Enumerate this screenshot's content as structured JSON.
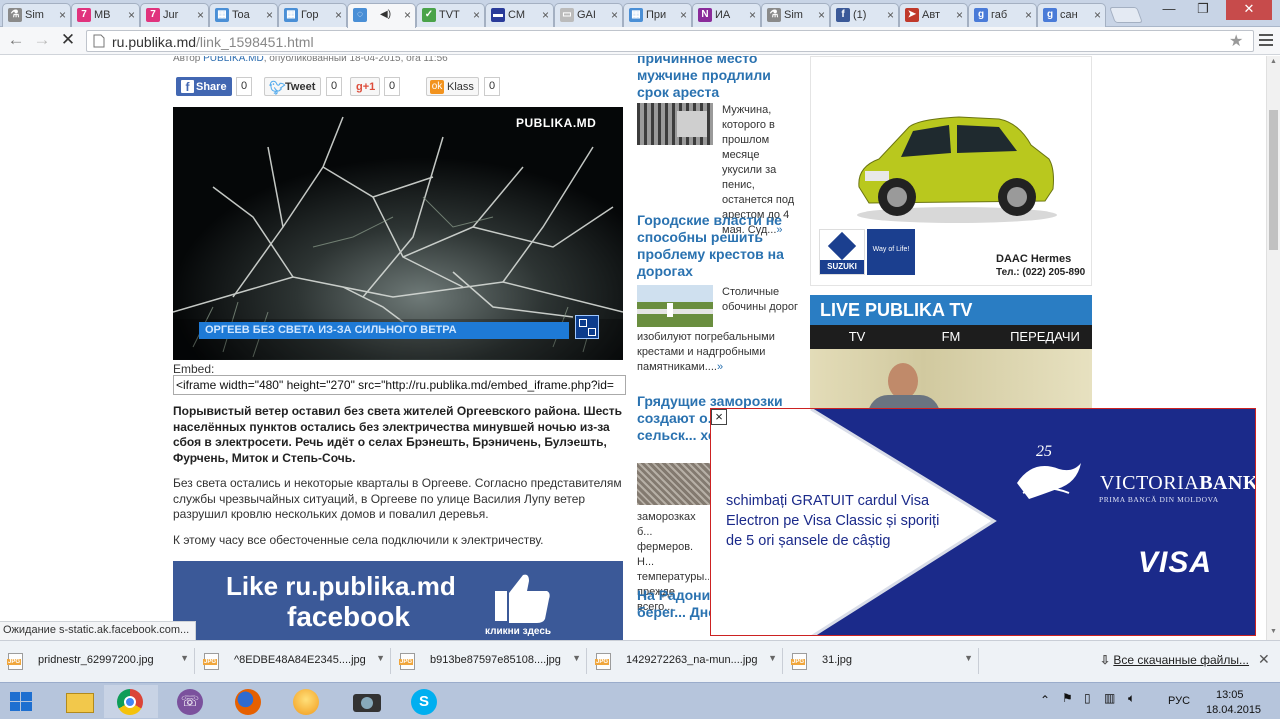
{
  "tabs": [
    {
      "label": "Sim",
      "icon": "flask-icon",
      "color": "#8a8a8a"
    },
    {
      "label": "MB",
      "icon": "seven-icon",
      "color": "#e0337d"
    },
    {
      "label": "Jur",
      "icon": "seven-icon",
      "color": "#e0337d"
    },
    {
      "label": "Toa",
      "icon": "grid-icon",
      "color": "#4a8fd6"
    },
    {
      "label": "Гор",
      "icon": "grid-icon",
      "color": "#4a8fd6"
    },
    {
      "label": "",
      "icon": "loading-icon",
      "color": "#4a8fd6",
      "audio": "◀)"
    },
    {
      "label": "TVT",
      "icon": "check-icon",
      "color": "#4aa34a"
    },
    {
      "label": "СМ",
      "icon": "flag-icon",
      "color": "#2a3b9a"
    },
    {
      "label": "GAI",
      "icon": "page-icon",
      "color": "#bbbbbb"
    },
    {
      "label": "При",
      "icon": "grid-icon",
      "color": "#4a8fd6"
    },
    {
      "label": "ИА",
      "icon": "news-icon",
      "color": "#8a2b9a"
    },
    {
      "label": "Sim",
      "icon": "flask-icon",
      "color": "#8a8a8a"
    },
    {
      "label": "(1)",
      "icon": "facebook-icon",
      "color": "#3b5998"
    },
    {
      "label": "Авт",
      "icon": "arrow-icon",
      "color": "#c0392b"
    },
    {
      "label": "габ",
      "icon": "google-icon",
      "color": "#4a7bd8"
    },
    {
      "label": "сан",
      "icon": "google-icon",
      "color": "#4a7bd8"
    }
  ],
  "address": {
    "host": "ru.publika.md",
    "path": "/link_1598451.html"
  },
  "article": {
    "author_prefix": "Автор",
    "author": "PUBLIKA.MD",
    "published": ", опубликованный 18-04-2015, ora 11:56",
    "share": [
      {
        "label": "Share",
        "count": "0"
      },
      {
        "label": "Tweet",
        "count": "0"
      },
      {
        "label": "g+1",
        "count": "0"
      },
      {
        "label": "Klass",
        "count": "0"
      }
    ],
    "video_watermark": "PUBLIKA.MD",
    "video_caption": "ОРГЕЕВ БЕЗ СВЕТА ИЗ-ЗА СИЛЬНОГО ВЕТРА",
    "embed_label": "Embed:",
    "embed_code": "<iframe width=\"480\" height=\"270\" src=\"http://ru.publika.md/embed_iframe.php?id=",
    "lead": "Порывистый ветер оставил без света жителей Оргеевского района. Шесть населённых пунктов остались без электричества минувшей ночью из-за сбоя в электросети. Речь идёт о селах Брэнешть, Брэничень, Булэешть, Фурчень, Миток и Степь-Сочь.",
    "p1": "Без света остались и некоторые кварталы в Оргееве. Согласно представителям службы чрезвычайных ситуаций, в Оргееве по улице Василия Лупу ветер разрушил кровлю нескольких домов и повалил деревья.",
    "p2": "К этому часу все обесточенные села подключили к электричеству.",
    "fb_banner": {
      "title": "Like ru.publika.md",
      "brand": "facebook",
      "cta": "кликни здесь"
    }
  },
  "news": [
    {
      "title": "причинное место мужчине продлили срок ареста",
      "excerpt": "Мужчина, которого в прошлом месяце укусили за пенис, останется под арестом до 4 мая. Суд..."
    },
    {
      "title": "Городские власти не способны решить проблему крестов на дорогах",
      "excerpt": "Столичные обочины дорог изобилуют погребальными крестами и надгробными памятниками...."
    },
    {
      "title": "Грядущие заморозки создают о... для сельск... хозяйства",
      "excerpt_visible": "заморозках б... фермеров. Н... температуры... прежде всего..."
    },
    {
      "title": "На Радонин... обоих берег... Днестра см..."
    }
  ],
  "more_symbol": "»",
  "car_ad": {
    "dealer": "DAAC Hermes",
    "phone": "Тел.: (022) 205-890",
    "brand": "SUZUKI",
    "slogan": "Way of Life!"
  },
  "live": {
    "title": "LIVE PUBLIKA TV",
    "tabs": [
      "TV",
      "FM",
      "ПЕРЕДАЧИ"
    ]
  },
  "popup": {
    "close": "×",
    "text": "schimbați GRATUIT cardul Visa Electron pe Visa Classic și sporiți de 5 ori șansele de câștig",
    "anniv": "25",
    "brand_a": "VICTORIA",
    "brand_b": "BANK",
    "tagline": "PRIMA BANCĂ DIN MOLDOVA",
    "visa": "VISA"
  },
  "status_text": "Ожидание s-static.ak.facebook.com...",
  "downloads": [
    "pridnestr_62997200.jpg",
    "^8EDBE48A84E2345....jpg",
    "b913be87597e85108....jpg",
    "1429272263_na-mun....jpg",
    "31.jpg"
  ],
  "all_downloads": "Все скачанные файлы...",
  "taskbar": [
    "start",
    "explorer",
    "chrome",
    "viber",
    "firefox",
    "rambler",
    "camera",
    "skype"
  ],
  "tray": {
    "lang": "РУС",
    "time": "13:05",
    "date": "18.04.2015"
  }
}
